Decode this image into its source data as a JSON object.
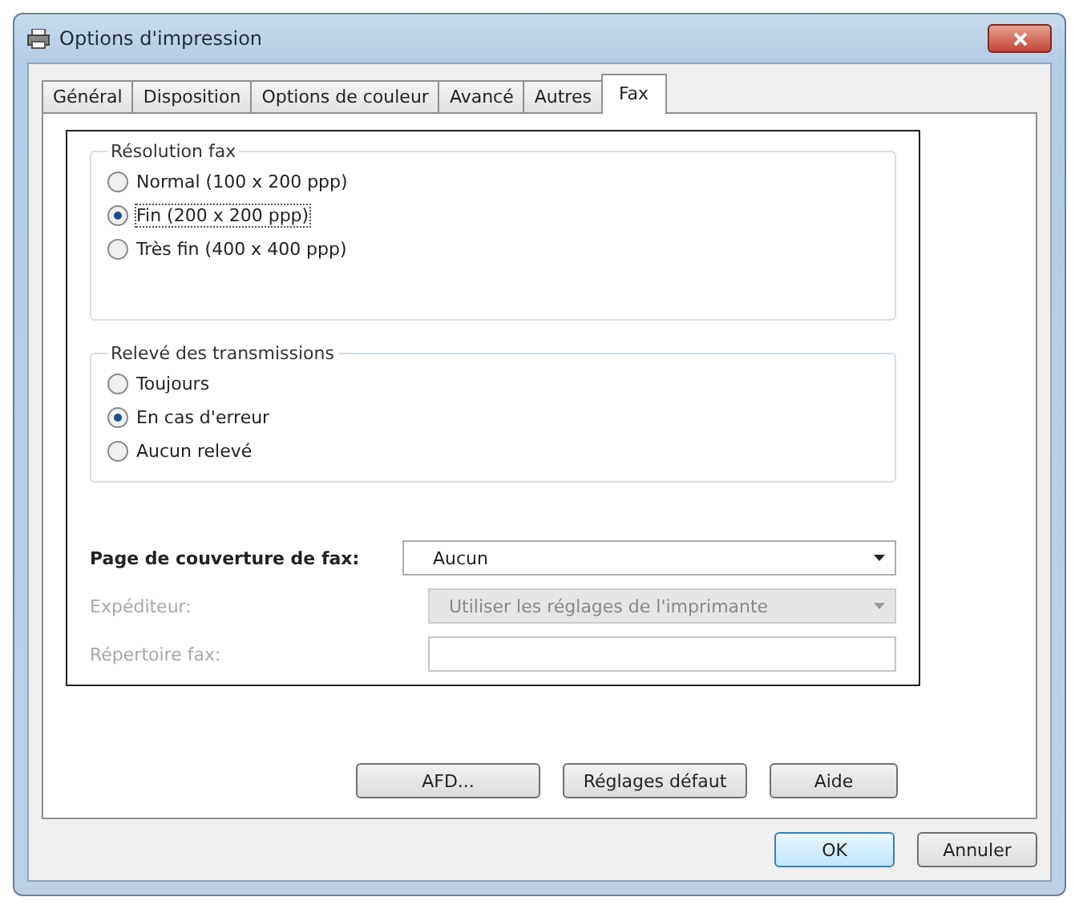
{
  "window": {
    "title": "Options d'impression"
  },
  "tabs": [
    {
      "label": "Général",
      "selected": false
    },
    {
      "label": "Disposition",
      "selected": false
    },
    {
      "label": "Options de couleur",
      "selected": false
    },
    {
      "label": "Avancé",
      "selected": false
    },
    {
      "label": "Autres",
      "selected": false
    },
    {
      "label": "Fax",
      "selected": true
    }
  ],
  "groups": [
    {
      "title": "Résolution fax",
      "options": [
        {
          "label": "Normal (100 x 200 ppp)",
          "selected": false
        },
        {
          "label": "Fin (200 x 200 ppp)",
          "selected": true
        },
        {
          "label": "Très fin (400 x 400 ppp)",
          "selected": false
        }
      ]
    },
    {
      "title": "Relevé des transmissions",
      "options": [
        {
          "label": "Toujours",
          "selected": false
        },
        {
          "label": "En cas d'erreur",
          "selected": true
        },
        {
          "label": "Aucun relevé",
          "selected": false
        }
      ]
    }
  ],
  "fields": [
    {
      "kind": "select",
      "label": "Page de couverture de fax:",
      "value": "Aucun",
      "disabled": false
    },
    {
      "kind": "select",
      "label": "Expéditeur:",
      "value": "Utiliser les réglages de l'imprimante",
      "disabled": true
    },
    {
      "kind": "text",
      "label": "Répertoire fax:",
      "disabled": true
    }
  ],
  "panel_buttons": [
    "AFD...",
    "Réglages défaut",
    "Aide"
  ],
  "dialog_buttons": [
    {
      "label": "OK",
      "default": true
    },
    {
      "label": "Annuler",
      "default": false
    }
  ]
}
